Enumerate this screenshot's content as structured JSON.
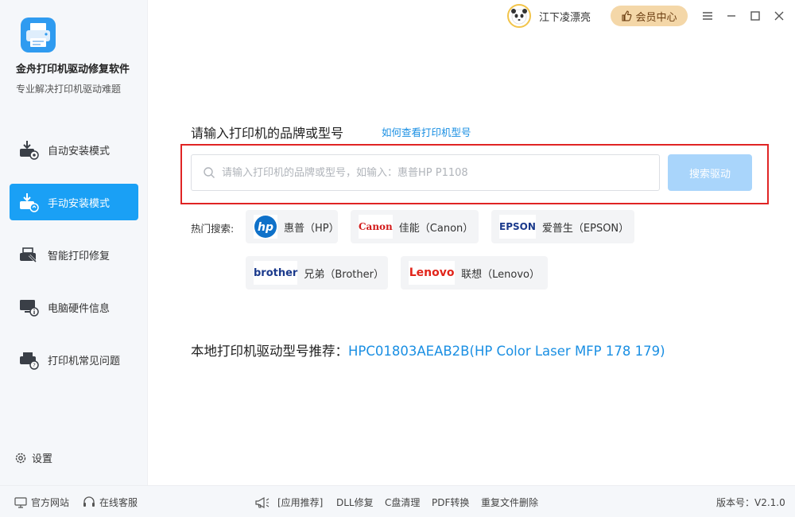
{
  "app": {
    "name": "金舟打印机驱动修复软件",
    "subtitle": "专业解决打印机驱动难题"
  },
  "user": {
    "name": "江下凌漂亮"
  },
  "vip": {
    "label": "会员中心"
  },
  "nav": {
    "items": [
      {
        "label": "自动安装模式",
        "icon": "auto-install-icon"
      },
      {
        "label": "手动安装模式",
        "icon": "manual-install-icon",
        "active": true
      },
      {
        "label": "智能打印修复",
        "icon": "printer-repair-icon"
      },
      {
        "label": "电脑硬件信息",
        "icon": "hardware-info-icon"
      },
      {
        "label": "打印机常见问题",
        "icon": "printer-faq-icon"
      }
    ],
    "settings_label": "设置"
  },
  "search": {
    "title": "请输入打印机的品牌或型号",
    "help_link": "如何查看打印机型号",
    "placeholder": "请输入打印机的品牌或型号，如输入：惠普HP P1108",
    "value": "",
    "button_label": "搜索驱动"
  },
  "hot": {
    "label": "热门搜索:",
    "brands": [
      {
        "logo": "hp",
        "label": "惠普（HP）"
      },
      {
        "logo": "Canon",
        "label": "佳能（Canon）"
      },
      {
        "logo": "EPSON",
        "label": "爱普生（EPSON）"
      },
      {
        "logo": "brother",
        "label": "兄弟（Brother）"
      },
      {
        "logo": "Lenovo",
        "label": "联想（Lenovo）"
      }
    ]
  },
  "local": {
    "label": "本地打印机驱动型号推荐：",
    "value": "HPC01803AEAB2B(HP Color Laser MFP 178 179)"
  },
  "footer": {
    "website": "官方网站",
    "support": "在线客服",
    "recommend": "[应用推荐]",
    "apps": [
      "DLL修复",
      "C盘清理",
      "PDF转换",
      "重复文件删除"
    ],
    "version": "版本号：V2.1.0"
  },
  "colors": {
    "accent": "#1aa0f5",
    "link": "#1a8fe3",
    "vip_bg": "#f4d7a8",
    "highlight_border": "#e02424"
  }
}
